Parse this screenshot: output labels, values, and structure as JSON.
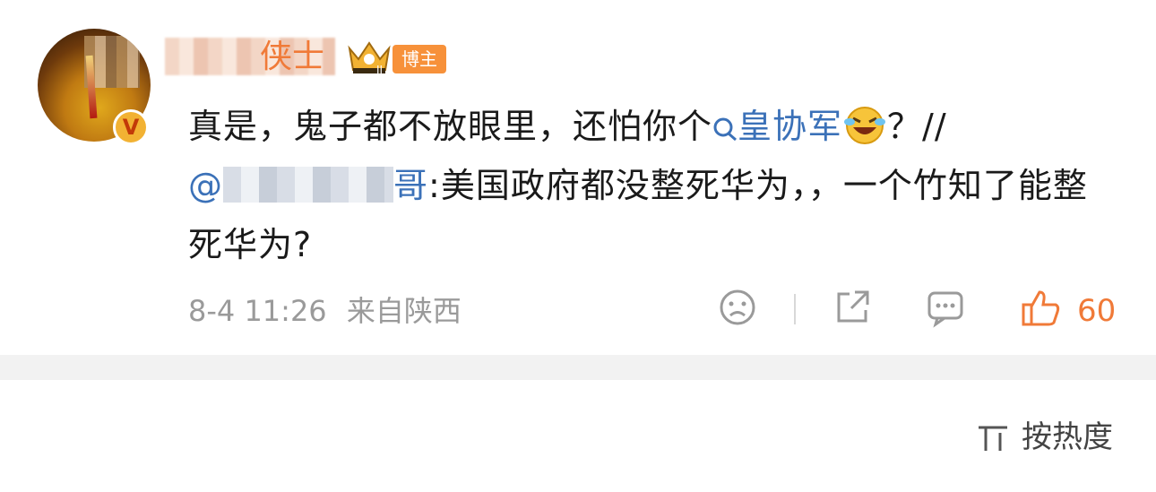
{
  "comment": {
    "author_suffix": "侠士",
    "badge_label": "博主",
    "verified_mark": "V",
    "text_before_topic": "真是，鬼子都不放眼里，还怕你个",
    "topic": "皇协军",
    "text_after_emoji": "？//",
    "mention_prefix": "@",
    "mention_suffix": "哥",
    "repost_text": ":美国政府都没整死华为，，一个竹知了能整死华为?",
    "date": "8-4 11:26",
    "location": "来自陕西",
    "like_count": "60"
  },
  "sort": {
    "label": "按热度"
  },
  "icons": [
    "search-topic-icon",
    "laughing-crying-emoji",
    "sad-face-icon",
    "share-icon",
    "comment-icon",
    "thumbs-up-icon",
    "sort-icon",
    "crown-icon"
  ],
  "colors": {
    "accent_orange": "#f07a38",
    "link_blue": "#3b71b8",
    "meta_gray": "#9a9a9a"
  }
}
